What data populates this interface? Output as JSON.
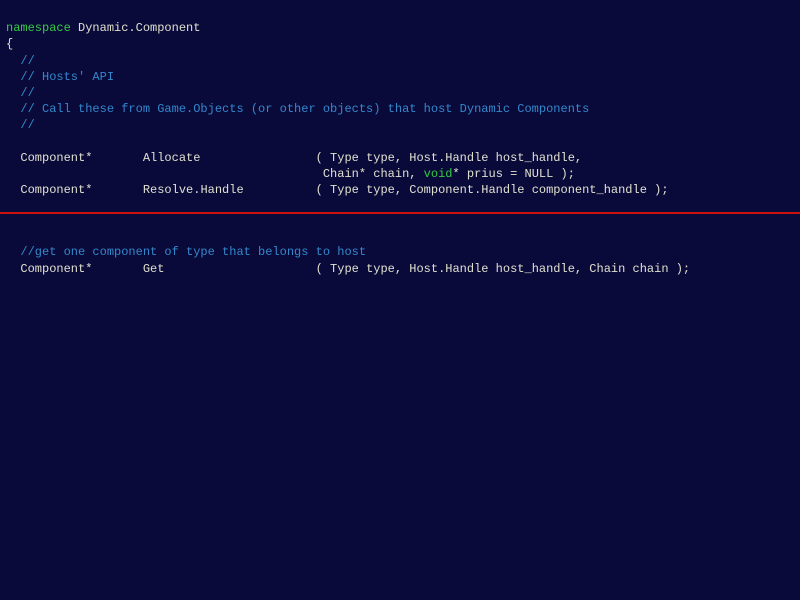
{
  "code": {
    "ns_keyword": "namespace",
    "ns_name": " Dynamic.Component",
    "brace_open": "{",
    "c1": "  //",
    "c2": "  // Hosts' API",
    "c3": "  //",
    "c4": "  // Call these from Game.Objects (or other objects) that host Dynamic Components",
    "c5": "  //",
    "fn1_ret": "  Component*       ",
    "fn1_name": "Allocate                ",
    "fn1_params_a": "( Type type, Host.Handle host_handle,",
    "fn1_params_b_indent": "                                            Chain* chain, ",
    "fn1_void": "void",
    "fn1_params_b_tail": "* prius = NULL );",
    "fn2_ret": "  Component*       ",
    "fn2_name": "Resolve.Handle          ",
    "fn2_params": "( Type type, Component.Handle component_handle );",
    "c6": "  //get one component of type that belongs to host",
    "fn3_ret": "  Component*       ",
    "fn3_name": "Get                     ",
    "fn3_params": "( Type type, Host.Handle host_handle, Chain chain );"
  }
}
